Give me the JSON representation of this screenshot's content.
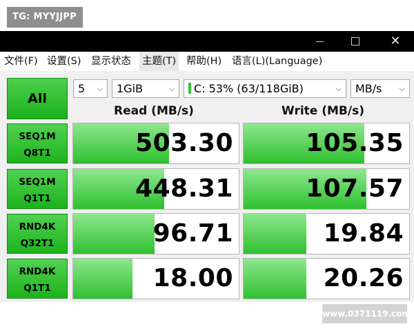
{
  "overlay": {
    "tg_label": "TG: MYYJJPP",
    "watermark": "www.0371119.com"
  },
  "window": {
    "close_glyph": "✕"
  },
  "menu": [
    "文件(F)",
    "设置(S)",
    "显示状态",
    "主题(T)",
    "帮助(H)",
    "语言(L)(Language)"
  ],
  "toolbar": {
    "all_label": "All",
    "count": "5",
    "size": "1GiB",
    "drive": "C: 53% (63/118GiB)",
    "unit": "MB/s"
  },
  "headers": {
    "read": "Read (MB/s)",
    "write": "Write (MB/s)"
  },
  "rows": [
    {
      "line1": "SEQ1M",
      "line2": "Q8T1",
      "read": "503.30",
      "write": "105.35",
      "read_level": 0.58,
      "write_level": 0.73
    },
    {
      "line1": "SEQ1M",
      "line2": "Q1T1",
      "read": "448.31",
      "write": "107.57",
      "read_level": 0.55,
      "write_level": 0.74
    },
    {
      "line1": "RND4K",
      "line2": "Q32T1",
      "read": "96.71",
      "write": "19.84",
      "read_level": 0.49,
      "write_level": 0.38
    },
    {
      "line1": "RND4K",
      "line2": "Q1T1",
      "read": "18.00",
      "write": "20.26",
      "read_level": 0.36,
      "write_level": 0.38
    }
  ],
  "colors": {
    "accent_green": "#19b019",
    "bar_green": "#2fc02f"
  }
}
